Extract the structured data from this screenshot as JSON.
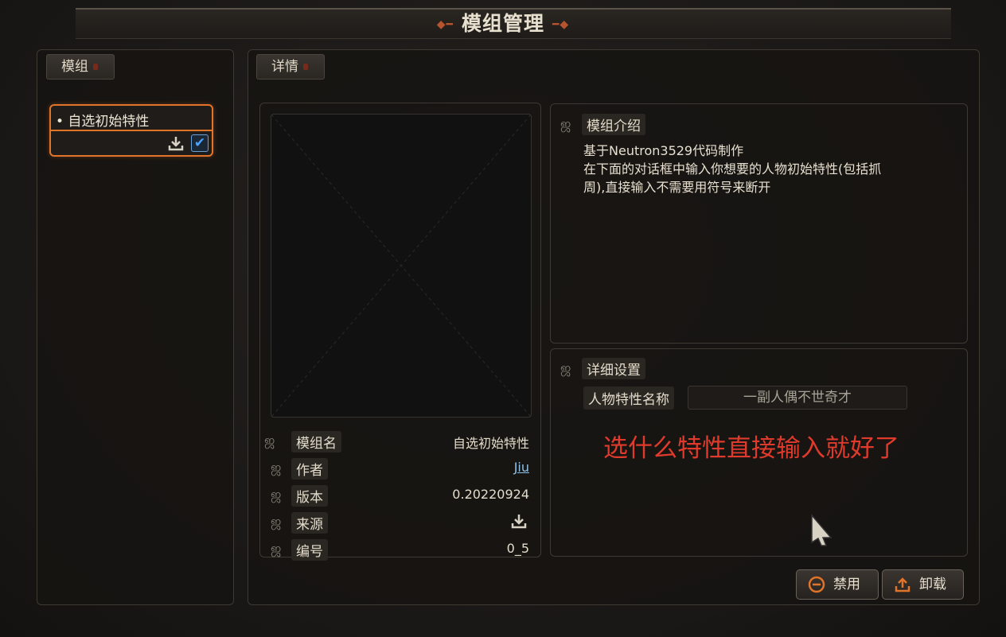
{
  "window": {
    "title": "模组管理"
  },
  "left_panel": {
    "tab_label": "模组"
  },
  "mod_list": [
    {
      "name": "• 自选初始特性",
      "enabled": true
    }
  ],
  "right_panel": {
    "tab_label": "详情"
  },
  "description": {
    "title": "模组介绍",
    "lines": [
      "基于Neutron3529代码制作",
      "在下面的对话框中输入你想要的人物初始特性(包括抓",
      "周),直接输入不需要用符号来断开"
    ]
  },
  "meta": {
    "name_key": "模组名",
    "name_val": "自选初始特性",
    "author_key": "作者",
    "author_val": "Jiu",
    "version_key": "版本",
    "version_val": "0.20220924",
    "source_key": "来源",
    "id_key": "编号",
    "id_val": "0_5"
  },
  "settings": {
    "title": "详细设置",
    "field_label": "人物特性名称",
    "field_value": "一副人偶不世奇才"
  },
  "annotation": "选什么特性直接输入就好了",
  "buttons": {
    "disable": "禁用",
    "unload": "卸载"
  },
  "colors": {
    "accent": "#e2742a",
    "annotation": "#e03a2c",
    "link": "#8fc0e8",
    "check": "#4aa3ff"
  },
  "icons": [
    "download-icon",
    "checkbox-checked-icon",
    "swirl-icon",
    "disable-icon",
    "unload-icon",
    "cursor-icon"
  ]
}
